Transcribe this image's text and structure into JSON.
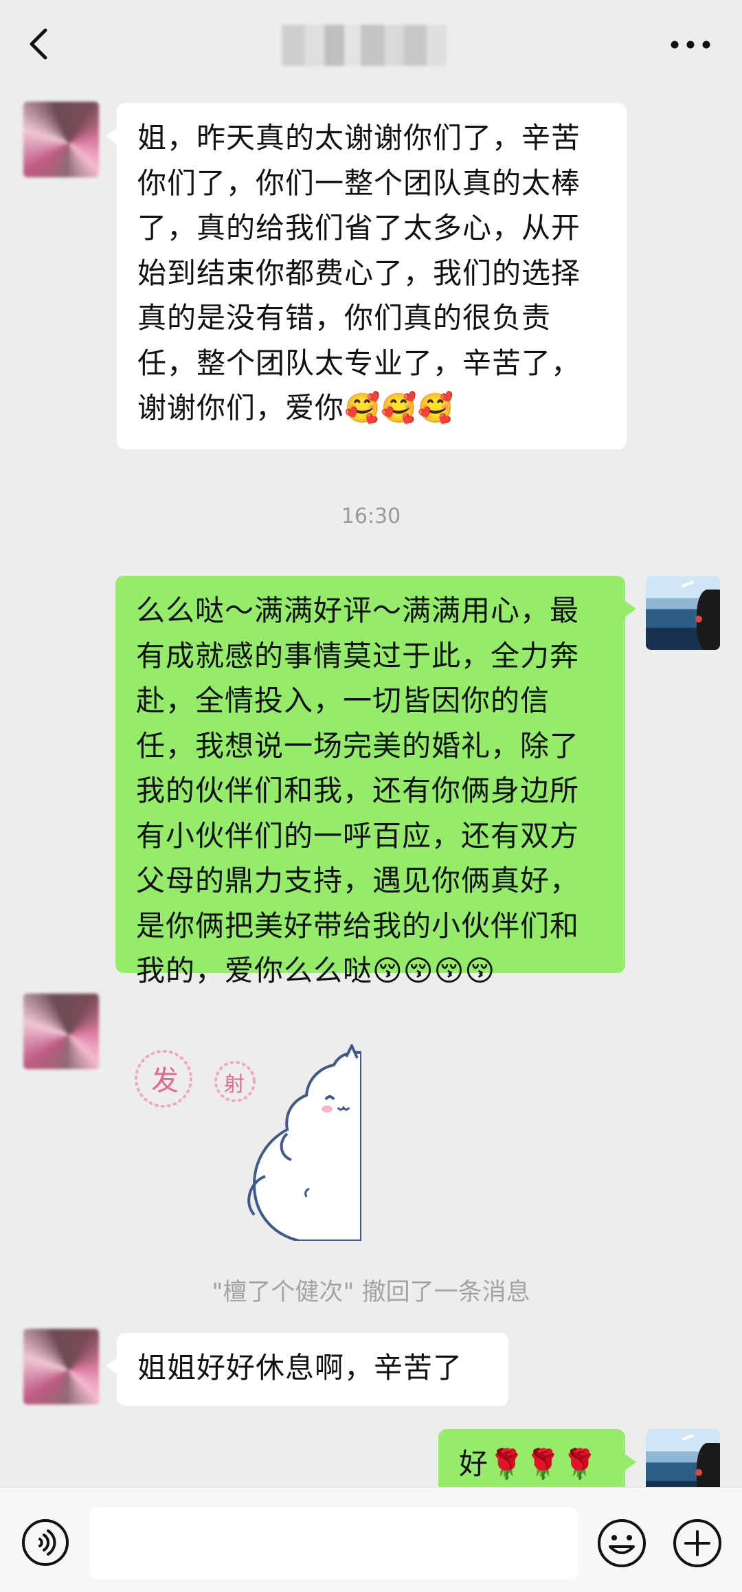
{
  "messages": {
    "m1": "姐，昨天真的太谢谢你们了，辛苦你们了，你们一整个团队真的太棒了，真的给我们省了太多心，从开始到结束你都费心了，我们的选择真的是没有错，你们真的很负责任，整个团队太专业了，辛苦了，谢谢你们，爱你🥰🥰🥰",
    "time": "16:30",
    "m2": "么么哒～满满好评～满满用心，最有成就感的事情莫过于此，全力奔赴，全情投入，一切皆因你的信任，我想说一场完美的婚礼，除了我的伙伴们和我，还有你俩身边所有小伙伴们的一呼百应，还有双方父母的鼎力支持，遇见你俩真好，是你俩把美好带给我的小伙伴们和我的，爱你么么哒😚😚😚😚",
    "sticker_text1": "发",
    "sticker_text2": "射",
    "recall": "\"檀了个健次\" 撤回了一条消息",
    "m3": "姐姐好好休息啊，辛苦了",
    "m4": "好🌹🌹🌹"
  },
  "icons": {
    "back": "chevron-left-icon",
    "more": "more-dots-icon",
    "voice": "voice-icon",
    "emoji": "emoji-icon",
    "plus": "plus-icon"
  },
  "colors": {
    "background": "#ededed",
    "bubble_out": "#95ec69",
    "bubble_in": "#ffffff",
    "meta_text": "#9a9a9a"
  }
}
